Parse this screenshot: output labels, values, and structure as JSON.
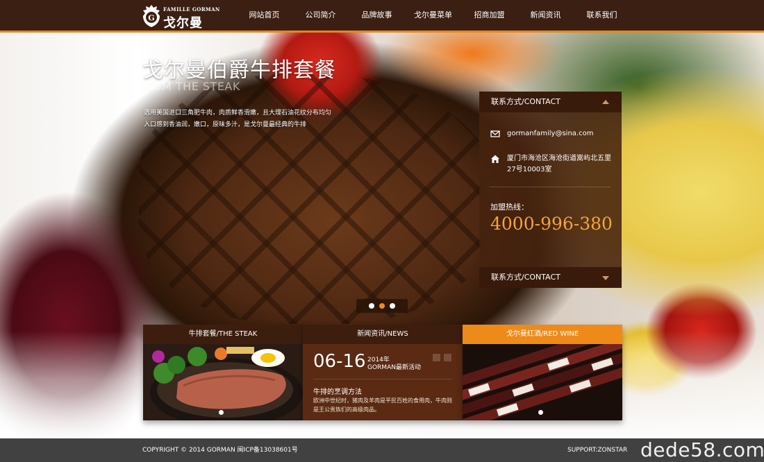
{
  "brand": {
    "tagline": "FAMILLE GORMAN",
    "name": "戈尔曼"
  },
  "nav": {
    "items": [
      {
        "label": "网站首页",
        "active": true
      },
      {
        "label": "公司简介",
        "active": false
      },
      {
        "label": "品牌故事",
        "active": false
      },
      {
        "label": "戈尔曼菜单",
        "active": false
      },
      {
        "label": "招商加盟",
        "active": false
      },
      {
        "label": "新闻资讯",
        "active": false
      },
      {
        "label": "联系我们",
        "active": false
      }
    ]
  },
  "hero": {
    "title": "戈尔曼伯爵牛排套餐",
    "subtitle": "GOM THE STEAK",
    "description": "选用美国进口三角肥牛肉，肉质鲜香滑嫩，且大理石油花纹分布均匀 入口感到香油润，嫩口，原味多汁，是戈尔曼最经典的牛排"
  },
  "contact": {
    "header": "联系方式/CONTACT",
    "email": "gormanfamily@sina.com",
    "address": "厦门市海沧区海沧街道嵩屿北五里27号10003室",
    "hotline_label": "加盟热线：",
    "hotline": "4000-996-380",
    "footer_header": "联系方式/CONTACT"
  },
  "slider": {
    "slide_count": 3,
    "active_index": 1
  },
  "boxes": {
    "steak": {
      "label": "牛排套餐/THE STEAK"
    },
    "news": {
      "label": "新闻资讯/NEWS",
      "date": "06-16",
      "year": "2014年",
      "tag": "GORMAN最新活动",
      "title": "牛排的烹调方法",
      "body": "欧洲中世纪时，猪肉及羊肉是平民百姓的食用肉，牛肉则是王公贵族们的高级肉品。"
    },
    "wine": {
      "label": "戈尔曼红酒/RED WINE"
    }
  },
  "footer": {
    "copyright": "COPYRIGHT © 2014  GORMAN  闽ICP备13038601号",
    "support": "SUPPORT:ZONSTAR",
    "watermark": "dede58.com"
  },
  "colors": {
    "nav_bg": "#3a1f12",
    "accent": "#e8861c",
    "hotline": "#f3a43b",
    "footer_bg": "#414141"
  },
  "icons": [
    "logo-crest-icon",
    "mail-icon",
    "home-icon",
    "chevron-up-icon",
    "chevron-down-icon"
  ]
}
